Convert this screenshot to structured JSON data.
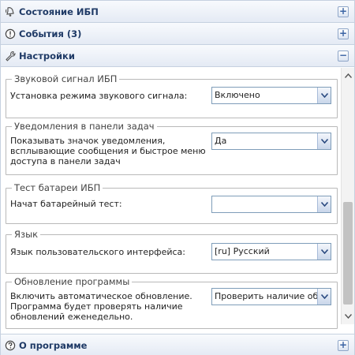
{
  "sections": {
    "ups_status": {
      "title": "Состояние ИБП",
      "icon": "bell-icon",
      "toggle": "+"
    },
    "events": {
      "title": "События (3)",
      "icon": "exclamation-circle-icon",
      "toggle": "+"
    },
    "settings": {
      "title": "Настройки",
      "icon": "wrench-icon",
      "toggle": "−"
    },
    "about": {
      "title": "О программе",
      "icon": "question-circle-icon",
      "toggle": "+"
    }
  },
  "settings": {
    "sound": {
      "legend": "Звуковой сигнал ИБП",
      "label": "Установка режима звукового сигнала:",
      "value": "Включено"
    },
    "tray": {
      "legend": "Уведомления в панели задач",
      "label": "Показывать значок уведомления, всплывающие сообщения и быстрое меню доступа в панели задач",
      "value": "Да"
    },
    "battery_test": {
      "legend": "Тест батареи ИБП",
      "label": "Начат батарейный тест:",
      "value": ""
    },
    "language": {
      "legend": "Язык",
      "label": "Язык пользовательского интерфейса:",
      "value": "[ru] Русский"
    },
    "update": {
      "legend": "Обновление программы",
      "label": "Включить автоматическое обновление. Программа будет проверять наличие обновлений еженедельно.",
      "value": "Проверить наличие обнов"
    }
  },
  "colors": {
    "header_text": "#1f3a66",
    "border": "#c6d1e0",
    "accent": "#3a63a3"
  }
}
